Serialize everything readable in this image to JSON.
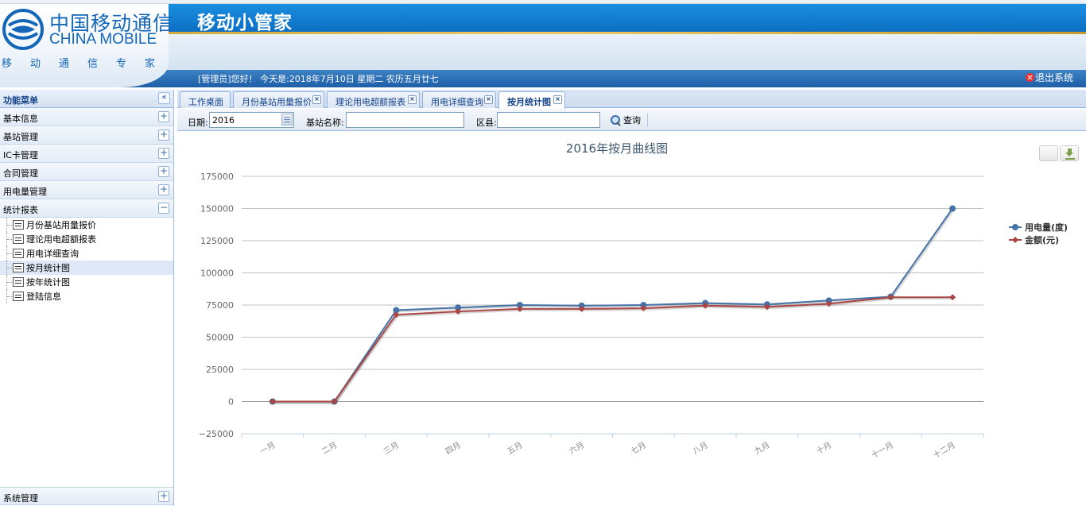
{
  "brand": {
    "cn": "中国移动通信",
    "en": "CHINA MOBILE",
    "slogan": "移动通信专家"
  },
  "app": {
    "title": "移动小管家",
    "welcome": "[管理员]您好！ 今天是:2018年7月10日 星期二 农历五月廿七",
    "logout": "退出系统"
  },
  "sidebar": {
    "title": "功能菜单",
    "collapse": "«",
    "sections": [
      {
        "label": "基本信息",
        "toggle": "+"
      },
      {
        "label": "基站管理",
        "toggle": "+"
      },
      {
        "label": "IC卡管理",
        "toggle": "+"
      },
      {
        "label": "合同管理",
        "toggle": "+"
      },
      {
        "label": "用电量管理",
        "toggle": "+"
      },
      {
        "label": "统计报表",
        "toggle": "−"
      }
    ],
    "report_items": [
      {
        "label": "月份基站用量报价"
      },
      {
        "label": "理论用电超额报表"
      },
      {
        "label": "用电详细查询"
      },
      {
        "label": "按月统计图"
      },
      {
        "label": "按年统计图"
      },
      {
        "label": "登陆信息"
      }
    ],
    "system": {
      "label": "系统管理",
      "toggle": "+"
    }
  },
  "tabs": [
    {
      "label": "工作桌面"
    },
    {
      "label": "月份基站用量报价",
      "close": "×"
    },
    {
      "label": "理论用电超额报表",
      "close": "×"
    },
    {
      "label": "用电详细查询",
      "close": "×"
    },
    {
      "label": "按月统计图",
      "close": "×"
    }
  ],
  "toolbar": {
    "date_label": "日期:",
    "date_value": "2016",
    "station_label": "基站名称:",
    "station_value": "",
    "district_label": "区县:",
    "district_value": "",
    "query_label": "查询"
  },
  "chart_data": {
    "type": "line",
    "title": "2016年按月曲线图",
    "categories": [
      "一月",
      "二月",
      "三月",
      "四月",
      "五月",
      "六月",
      "七月",
      "八月",
      "九月",
      "十月",
      "十一月",
      "十二月"
    ],
    "series": [
      {
        "name": "用电量(度)",
        "color": "#4572a7",
        "marker": "circle",
        "values": [
          0,
          0,
          71000,
          73000,
          75000,
          74500,
          75000,
          76500,
          75500,
          78500,
          81500,
          150000
        ]
      },
      {
        "name": "金额(元)",
        "color": "#aa4643",
        "marker": "diamond",
        "values": [
          0,
          0,
          67500,
          70000,
          72000,
          72000,
          72500,
          74500,
          73500,
          76000,
          81000,
          81000
        ]
      }
    ],
    "ylim": [
      -25000,
      175000
    ],
    "yticks": [
      -25000,
      0,
      25000,
      50000,
      75000,
      100000,
      125000,
      150000,
      175000
    ],
    "grid": true,
    "legend": "right"
  }
}
